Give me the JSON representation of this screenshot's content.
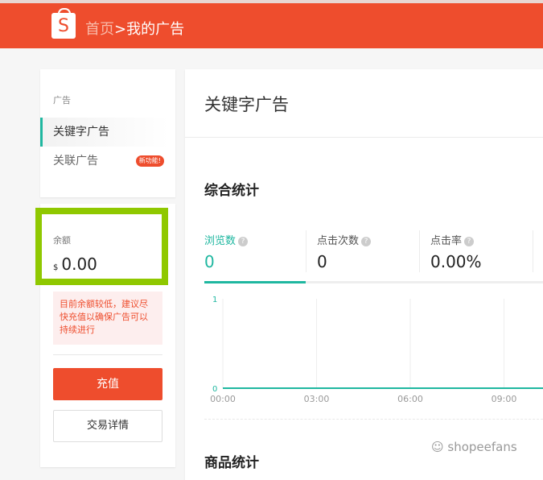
{
  "header": {
    "logo": "S",
    "home": "首页",
    "separator": ">",
    "current": "我的广告"
  },
  "sidebar": {
    "section": "广告",
    "items": [
      {
        "label": "关键字广告",
        "active": true
      },
      {
        "label": "关联广告",
        "badge": "新功能!"
      }
    ]
  },
  "balance": {
    "label": "余额",
    "currency": "$",
    "amount": "0.00",
    "warning": "目前余额较低，建议尽快充值以确保广告可以持续进行",
    "topup_label": "充值",
    "details_label": "交易详情"
  },
  "main": {
    "title": "关键字广告",
    "overview_title": "综合统计",
    "product_title": "商品统计",
    "metrics": [
      {
        "label": "浏览数",
        "value": "0",
        "help": "?"
      },
      {
        "label": "点击次数",
        "value": "0",
        "help": "?"
      },
      {
        "label": "点击率",
        "value": "0.00%",
        "help": "?"
      }
    ]
  },
  "chart_data": {
    "type": "line",
    "x": [
      "00:00",
      "03:00",
      "06:00",
      "09:00"
    ],
    "series": [
      {
        "name": "浏览数",
        "values": [
          0,
          0,
          0,
          0
        ]
      }
    ],
    "ylim": [
      0,
      1
    ],
    "yticks": [
      "0",
      "1"
    ],
    "color": "#1fb7a0"
  },
  "watermark": "shopeefans"
}
